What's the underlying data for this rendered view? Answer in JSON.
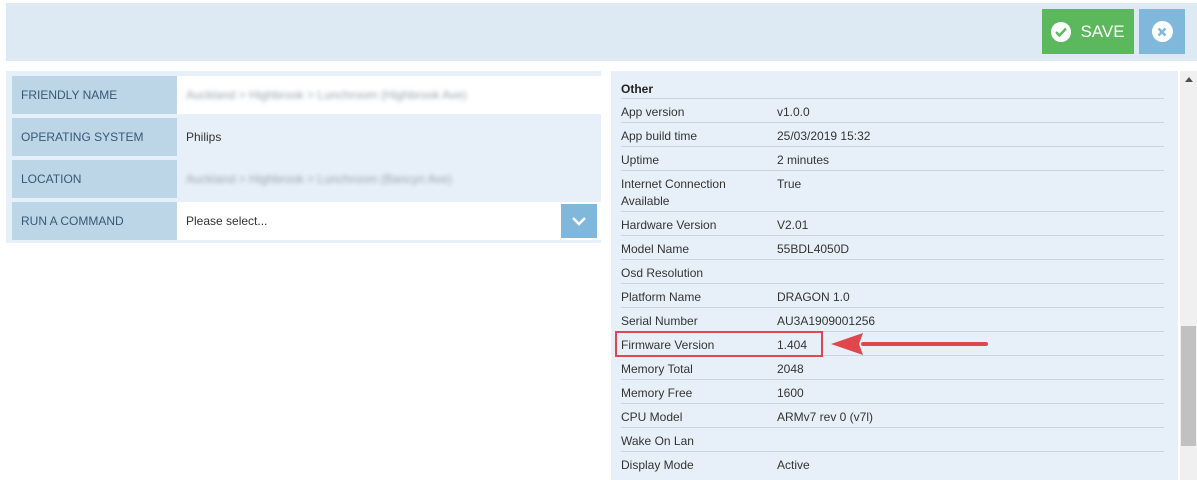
{
  "toolbar": {
    "save_label": "SAVE",
    "save_icon": "check-circle-icon",
    "close_icon": "close-circle-icon",
    "save_color": "#5cb85c",
    "close_color": "#7fb8db"
  },
  "form": {
    "friendly_name_label": "FRIENDLY NAME",
    "friendly_name_value": "Auckland > Highbrook > Lunchroom (Highbrook Ave)",
    "os_label": "OPERATING SYSTEM",
    "os_value": "Philips",
    "location_label": "LOCATION",
    "location_value": "Auckland > Highbrook > Lunchroom (Bancyn Ave)",
    "command_label": "RUN A COMMAND",
    "command_placeholder": "Please select..."
  },
  "info": {
    "title": "Other",
    "rows": [
      {
        "key": "App version",
        "value": "v1.0.0"
      },
      {
        "key": "App build time",
        "value": "25/03/2019 15:32"
      },
      {
        "key": "Uptime",
        "value": "2 minutes"
      },
      {
        "key": "Internet Connection Available",
        "value": "True"
      },
      {
        "key": "Hardware Version",
        "value": "V2.01"
      },
      {
        "key": "Model Name",
        "value": "55BDL4050D"
      },
      {
        "key": "Osd Resolution",
        "value": ""
      },
      {
        "key": "Platform Name",
        "value": "DRAGON 1.0"
      },
      {
        "key": "Serial Number",
        "value": "AU3A1909001256"
      },
      {
        "key": "Firmware Version",
        "value": "1.404"
      },
      {
        "key": "Memory Total",
        "value": "2048"
      },
      {
        "key": "Memory Free",
        "value": "1600"
      },
      {
        "key": "CPU Model",
        "value": "ARMv7 rev 0 (v7l)"
      },
      {
        "key": "Wake On Lan",
        "value": ""
      },
      {
        "key": "Display Mode",
        "value": "Active"
      }
    ]
  },
  "annotation": {
    "color": "#e0474c"
  }
}
